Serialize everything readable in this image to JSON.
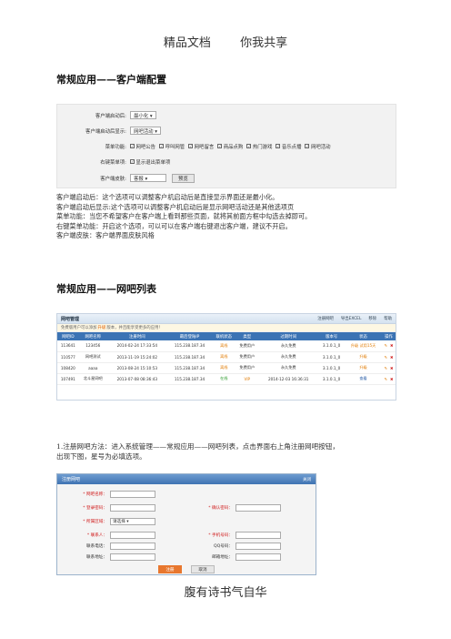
{
  "header": {
    "left": "精品文档",
    "right": "你我共享"
  },
  "section1": {
    "title": "常规应用——客户端配置",
    "config": {
      "rows": [
        {
          "label": "客户端启动后:",
          "value": "最小化 ▾"
        },
        {
          "label": "客户端启动后显示:",
          "value": "网吧活动 ▾"
        },
        {
          "label": "菜单功能:",
          "checks": [
            "网吧公告",
            "呼叫网管",
            "网吧留言",
            "商品点购",
            "热门游戏",
            "音乐点播",
            "网吧活动"
          ]
        },
        {
          "label": "右键菜单项:",
          "checks": [
            "显示退出菜单项"
          ]
        },
        {
          "label": "客户端皮肤:",
          "value": "客报 ▾",
          "button": "预览"
        }
      ]
    },
    "lines": [
      "客户端启动后：这个选项可以调整客户机启动后是直接显示界面还是最小化。",
      "客户端启动后显示:这个选项可以调整客户机启动后是显示网吧活动还是其他选项页",
      "菜单功能：当您不希望客户在客户端上看到那些页面，就将其前面方框中勾选去掉即可。",
      "右键菜单功能：开启这个选项，可以可以在客户端右键退出客户端，建议不开启。",
      "客户端皮肤：客户端界面皮肤风格"
    ]
  },
  "section2": {
    "title": "常规应用——网吧列表",
    "panel": {
      "title": "网吧管理",
      "actions": [
        "注册网吧",
        "导出EXCEL",
        "移除",
        "帮助"
      ],
      "notice": {
        "a": "免费版用户可以添加",
        "b": "升级",
        "c": "版本，并且能享受更多的应用！"
      },
      "headers": [
        "网吧ID",
        "网吧名称",
        "注册时间",
        "最后登陆IP",
        "联机状态",
        "类型",
        "过期时间",
        "版本号",
        "状态",
        "操作"
      ],
      "rows": [
        [
          "113641",
          "123456",
          "2014-02-24 17:33:54",
          "115.238.187.34",
          "离线",
          "免费用户",
          "永久免费",
          "3.1.0.1_0",
          "升级",
          "试用15天"
        ],
        [
          "110577",
          "网吧测试",
          "2013-11-19 15:24:02",
          "115.238.187.34",
          "离线",
          "免费用户",
          "永久免费",
          "3.1.0.1_0",
          "升级",
          ""
        ],
        [
          "108420",
          "aaaa",
          "2013-08-24 15:10:53",
          "115.238.187.34",
          "离线",
          "免费用户",
          "永久免费",
          "3.1.0.1_0",
          "升级",
          ""
        ],
        [
          "107491",
          "北斗星网吧",
          "2013-07-08 08:36:43",
          "115.238.187.34",
          "在线",
          "VIP",
          "2014-12-03 16:36:31",
          "3.1.0.1_0",
          "查看",
          ""
        ]
      ]
    },
    "lines": [
      "1.注册网吧方法：进入系统管理——常规应用——网吧列表，点击界面右上角注册网吧按钮，",
      "出现下图，星号为必填选项。"
    ]
  },
  "dialog": {
    "title": "注册网吧",
    "close": "关闭",
    "fields": {
      "name": "* 网吧名称：",
      "pwd": "* 登录密码：",
      "confirm": "* 确认密码：",
      "region": "* 所属区域：",
      "region_val": "请选择 ▾",
      "contact": "* 联系人：",
      "mobile": "* 手机号码：",
      "tel": "联系电话：",
      "qq": "QQ号码：",
      "addr": "联系地址：",
      "email": "邮箱地址："
    },
    "ok": "注册",
    "cancel": "取消"
  },
  "footer": "腹有诗书气自华"
}
